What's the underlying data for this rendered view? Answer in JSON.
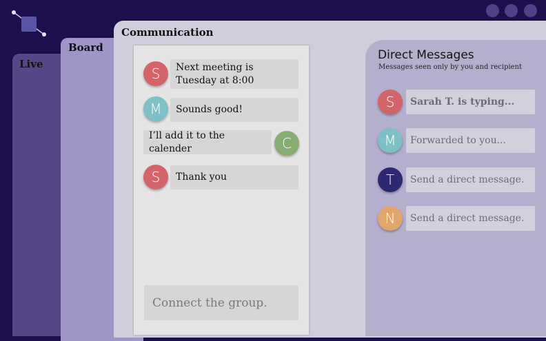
{
  "window_controls": [
    {
      "name": "window-button-1"
    },
    {
      "name": "window-button-2"
    },
    {
      "name": "window-button-3"
    }
  ],
  "panels": {
    "live": {
      "title": "Live"
    },
    "board": {
      "title": "Board"
    },
    "communication": {
      "title": "Communication"
    }
  },
  "chat": {
    "messages": [
      {
        "avatar": "S",
        "text": "Next meeting is Tuesday at 8:00",
        "side": "left",
        "color": "#d2646a"
      },
      {
        "avatar": "M",
        "text": "Sounds good!",
        "side": "left",
        "color": "#7fbfc6"
      },
      {
        "avatar": "C",
        "text": "I’ll add it to the calender",
        "side": "right",
        "color": "#86ad72"
      },
      {
        "avatar": "S",
        "text": "Thank you",
        "side": "left",
        "color": "#d2646a"
      }
    ],
    "input_placeholder": "Connect the group."
  },
  "direct_messages": {
    "title": "Direct Messages",
    "subtitle": "Messages seen only by you and recipient",
    "rows": [
      {
        "avatar": "S",
        "text": "Sarah T. is typing...",
        "bold": true,
        "color": "#d2646a"
      },
      {
        "avatar": "M",
        "text": "Forwarded to you...",
        "bold": false,
        "color": "#7fbfc6"
      },
      {
        "avatar": "T",
        "text": "Send a direct message.",
        "bold": false,
        "color": "#2e2872"
      },
      {
        "avatar": "N",
        "text": "Send a direct message.",
        "bold": false,
        "color": "#e0a66b"
      }
    ]
  }
}
